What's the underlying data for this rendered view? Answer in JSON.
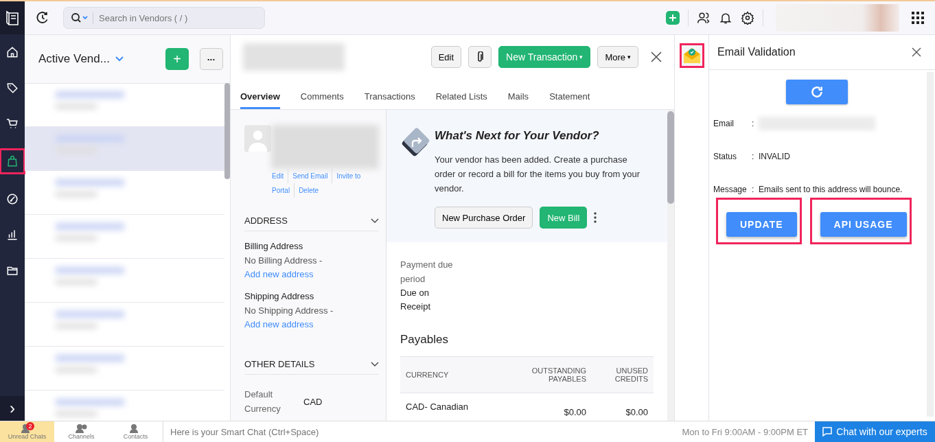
{
  "sidebar": {
    "items": [
      {
        "kind": "home",
        "selected": false,
        "highlighted": false
      },
      {
        "kind": "tag",
        "selected": false,
        "highlighted": false
      },
      {
        "kind": "cart",
        "selected": false,
        "highlighted": false
      },
      {
        "kind": "bag",
        "selected": true,
        "highlighted": true
      },
      {
        "kind": "gauge",
        "selected": false,
        "highlighted": false
      },
      {
        "kind": "chart",
        "selected": false,
        "highlighted": false
      },
      {
        "kind": "folder",
        "selected": false,
        "highlighted": false
      }
    ],
    "expand": "›"
  },
  "topbar": {
    "search": {
      "placeholder": "Search in Vendors ( / )"
    }
  },
  "vendor_list": {
    "title": "Active Vend...",
    "add": "+",
    "more": "•••",
    "rows": [
      {
        "selected": false
      },
      {
        "selected": true
      },
      {
        "selected": false
      },
      {
        "selected": false
      },
      {
        "selected": false
      },
      {
        "selected": false
      },
      {
        "selected": false
      },
      {
        "selected": false
      }
    ]
  },
  "detail": {
    "buttons": [
      {
        "label": "Edit",
        "kind": "plain"
      },
      {
        "kind": "attach"
      },
      {
        "label": "New Transaction",
        "kind": "primary",
        "caret": "▾"
      },
      {
        "label": "More",
        "kind": "dropdown",
        "caret": "▾"
      }
    ],
    "tabs": [
      {
        "label": "Overview",
        "selected": true
      },
      {
        "label": "Comments",
        "selected": false
      },
      {
        "label": "Transactions",
        "selected": false
      },
      {
        "label": "Related Lists",
        "selected": false
      },
      {
        "label": "Mails",
        "selected": false
      },
      {
        "label": "Statement",
        "selected": false
      }
    ],
    "contact_links": [
      "Edit",
      "Send Email",
      "Invite to",
      "Portal",
      "Delete"
    ],
    "address": {
      "heading": "ADDRESS",
      "billing_label": "Billing Address",
      "billing_value": "No Billing Address - ",
      "billing_link": "Add new address",
      "shipping_label": "Shipping Address",
      "shipping_value": "No Shipping Address - ",
      "shipping_link": "Add new address"
    },
    "other": {
      "heading": "OTHER DETAILS",
      "label": "Default Currency",
      "value": "CAD"
    },
    "next": {
      "title": "What's Next for Your Vendor?",
      "text": "Your vendor has been added. Create a purchase order or record a bill for the items you buy from your vendor.",
      "buttons": [
        "New Purchase Order",
        "New Bill"
      ]
    },
    "payment": {
      "label": "Payment due period",
      "value": "Due on Receipt"
    },
    "payables": {
      "title": "Payables",
      "columns": [
        "CURRENCY",
        "OUTSTANDING PAYABLES",
        "UNUSED CREDITS"
      ],
      "rows": [
        [
          "CAD- Canadian",
          "$0.00",
          "$0.00"
        ]
      ]
    }
  },
  "email_validation": {
    "app_highlighted": true,
    "title": "Email Validation",
    "fields": [
      {
        "label": "Email",
        "separator": ":"
      },
      {
        "label": "Status",
        "separator": ":",
        "value": "INVALID"
      },
      {
        "label": "Message",
        "separator": ":",
        "value": "Emails sent to this address will bounce."
      }
    ],
    "buttons": [
      {
        "label": "UPDATE",
        "highlighted": true
      },
      {
        "label": "API USAGE",
        "highlighted": true
      }
    ]
  },
  "bottom_bar": {
    "tabs": [
      {
        "label": "Unread Chats",
        "badge": "2",
        "selected": true
      },
      {
        "label": "Channels",
        "selected": false
      },
      {
        "label": "Contacts",
        "selected": false
      }
    ],
    "chat_placeholder": "Here is your Smart Chat (Ctrl+Space)",
    "hours": "Mon to Fri 9:00AM - 9:00PM ET",
    "chat_button": "Chat with our experts"
  }
}
